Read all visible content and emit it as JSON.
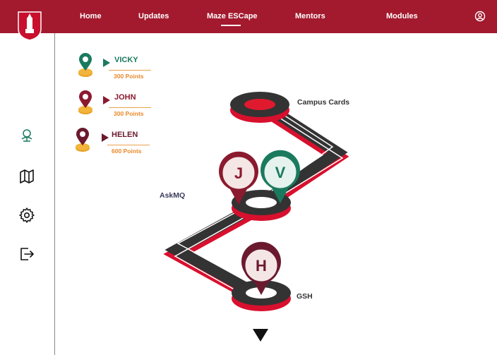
{
  "nav": {
    "items": [
      {
        "label": "Home"
      },
      {
        "label": "Updates"
      },
      {
        "label": "Maze ESCape"
      },
      {
        "label": "Mentors"
      },
      {
        "label": "Modules"
      }
    ],
    "active": "Maze ESCape"
  },
  "sidebar": {
    "items": [
      "leaderboard-icon",
      "map-icon",
      "gear-icon",
      "logout-icon"
    ]
  },
  "leaderboard": [
    {
      "name": "VICKY",
      "points": "300 Points",
      "color": "#1a7a5e"
    },
    {
      "name": "JOHN",
      "points": "300 Points",
      "color": "#8b1a2e"
    },
    {
      "name": "HELEN",
      "points": "600 Points",
      "color": "#6b1a2e"
    }
  ],
  "map": {
    "locations": {
      "campus_cards": "Campus Cards",
      "askmq": "AskMQ",
      "gsh": "GSH"
    },
    "markers": {
      "j": "J",
      "v": "V",
      "h": "H"
    }
  },
  "colors": {
    "brand": "#a3192e",
    "track": "#333333",
    "accent_orange": "#e8892a",
    "green": "#1a7a5e"
  }
}
